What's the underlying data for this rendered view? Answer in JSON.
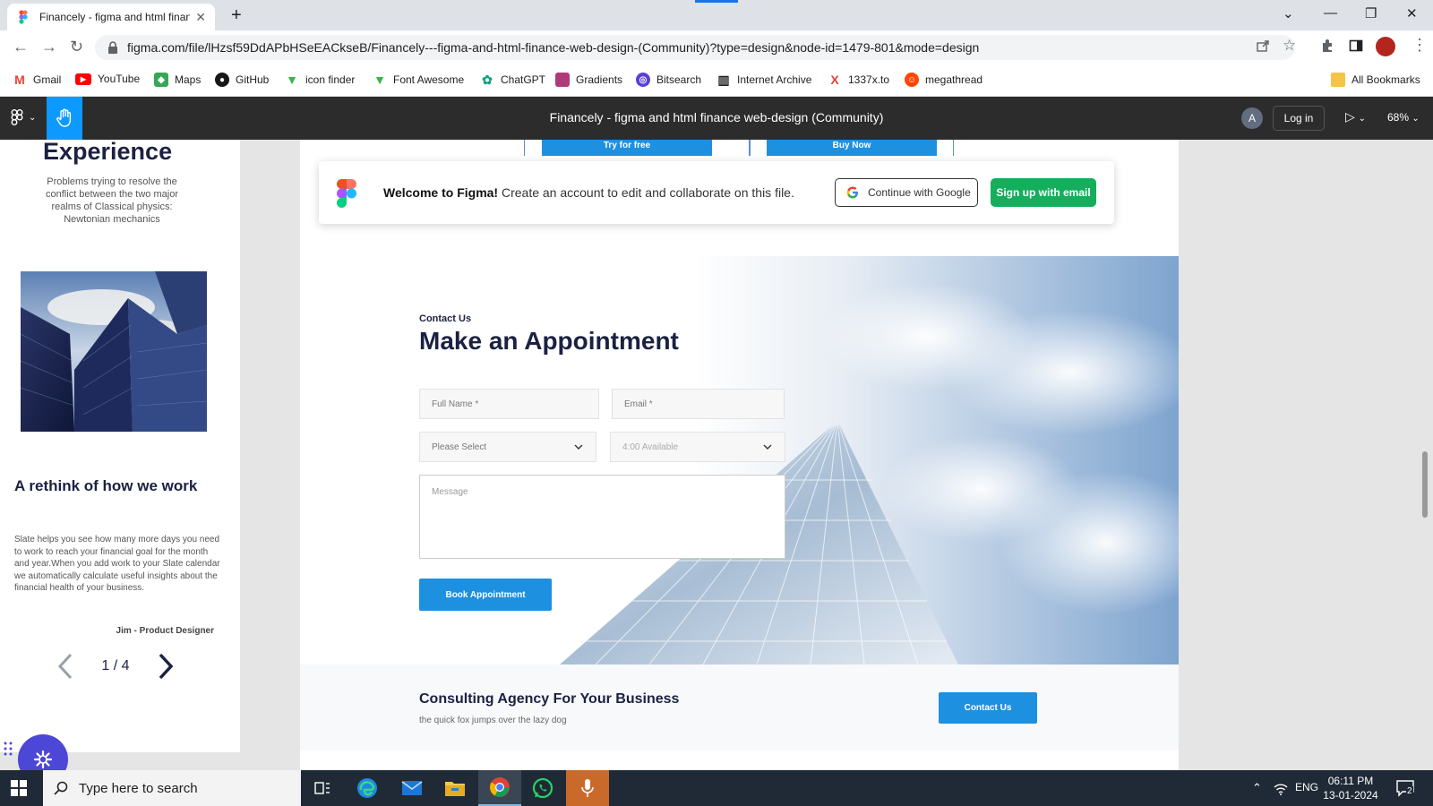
{
  "browser": {
    "tab_title": "Financely - figma and html finan",
    "url": "figma.com/file/lHzsf59DdAPbHSeEACkseB/Financely---figma-and-html-finance-web-design-(Community)?type=design&node-id=1479-801&mode=design",
    "bookmarks": [
      {
        "label": "Gmail",
        "icon": "gmail-icon",
        "color": "#ea4335"
      },
      {
        "label": "YouTube",
        "icon": "youtube-icon",
        "color": "#ff0000"
      },
      {
        "label": "Maps",
        "icon": "maps-icon",
        "color": "#34a853"
      },
      {
        "label": "GitHub",
        "icon": "github-icon",
        "color": "#181717"
      },
      {
        "label": "icon finder",
        "icon": "iconfinder-icon",
        "color": "#3ab54a"
      },
      {
        "label": "Font Awesome",
        "icon": "fontawesome-icon",
        "color": "#3ab54a"
      },
      {
        "label": "ChatGPT",
        "icon": "chatgpt-icon",
        "color": "#10a37f"
      },
      {
        "label": "Gradients",
        "icon": "gradients-icon",
        "color": "#b03a78"
      },
      {
        "label": "Bitsearch",
        "icon": "bitsearch-icon",
        "color": "#5b3fd9"
      },
      {
        "label": "Internet Archive",
        "icon": "archive-icon",
        "color": "#222222"
      },
      {
        "label": "1337x.to",
        "icon": "1337x-icon",
        "color": "#e8412b"
      },
      {
        "label": "megathread",
        "icon": "reddit-icon",
        "color": "#ff4500"
      }
    ],
    "all_bookmarks": "All Bookmarks"
  },
  "figma": {
    "file_title": "Financely - figma and html finance web-design (Community)",
    "avatar_letter": "A",
    "login_label": "Log in",
    "zoom": "68%"
  },
  "welcome": {
    "bold": "Welcome to Figma!",
    "text": " Create an account to edit and collaborate on this file.",
    "google_label": "Continue with Google",
    "email_label": "Sign up with email"
  },
  "left": {
    "exp_title": "Experience",
    "exp_desc": "Problems trying to resolve the conflict between the two major realms of Classical physics: Newtonian mechanics",
    "rethink_title": "A rethink of how we work",
    "rethink_body": "Slate helps you see how many more days you need to work to reach your financial goal for the month and year.When you add work to your Slate calendar we automatically calculate useful insights about the financial health of your business.",
    "author": "Jim - Product Designer",
    "page": "1 / 4"
  },
  "pricing": {
    "try_label": "Try for free",
    "buy_label": "Buy Now"
  },
  "appointment": {
    "eyebrow": "Contact Us",
    "title": "Make an Appointment",
    "full_name": "Full Name *",
    "email": "Email *",
    "select": "Please Select",
    "time": "4:00 Available",
    "message": "Message",
    "book_label": "Book Appointment"
  },
  "consult": {
    "title": "Consulting Agency For Your Business",
    "subtitle": "the quick fox jumps over the lazy dog",
    "contact_label": "Contact Us"
  },
  "taskbar": {
    "search_placeholder": "Type here to search",
    "lang": "ENG",
    "time": "06:11 PM",
    "date": "13-01-2024",
    "notif_count": "2"
  }
}
